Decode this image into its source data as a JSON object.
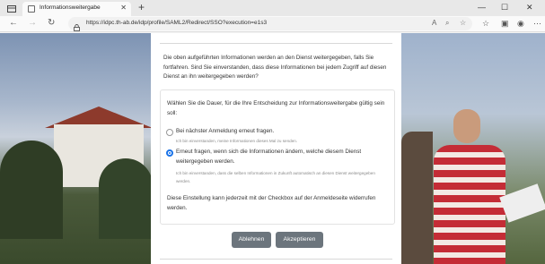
{
  "browser": {
    "tab_title": "Informationsweitergabe",
    "new_tab": "+",
    "url": "https://idpc.th-ab.de/idp/profile/SAML2/Redirect/SSO?execution=e1s3",
    "window_controls": [
      "—",
      "☐",
      "✕"
    ],
    "icons": [
      "back-icon",
      "forward-icon",
      "reload-icon",
      "lock-icon",
      "read-aloud-icon",
      "zoom-icon",
      "favorite-icon",
      "favorites-bar-icon",
      "collections-icon",
      "profile-icon",
      "menu-icon"
    ]
  },
  "consent": {
    "intro": "Die oben aufgeführten Informationen werden an den Dienst weitergegeben, falls Sie fortfahren. Sind Sie einverstanden, dass diese Informationen bei jedem Zugriff auf diesen Dienst an ihn weitergegeben werden?",
    "question": "Wählen Sie die Dauer, für die Ihre Entscheidung zur Informationsweitergabe gültig sein soll:",
    "options": [
      {
        "label": "Bei nächster Anmeldung erneut fragen.",
        "sub": "Ich bin einverstanden, meine Informationen dieses Mal zu senden.",
        "checked": false
      },
      {
        "label": "Erneut fragen, wenn sich die Informationen ändern, welche diesem Dienst weitergegeben werden.",
        "sub": "Ich bin einverstanden, dass die selben Informationen in Zukunft automatisch an diesen Dienst weitergegeben werden.",
        "checked": true
      }
    ],
    "note": "Diese Einstellung kann jederzeit mit der Checkbox auf der Anmeldeseite widerrufen werden.",
    "reject_label": "Ablehnen",
    "accept_label": "Akzeptieren"
  },
  "colors": {
    "button_bg": "#6c757d",
    "radio_accent": "#1a73e8"
  }
}
